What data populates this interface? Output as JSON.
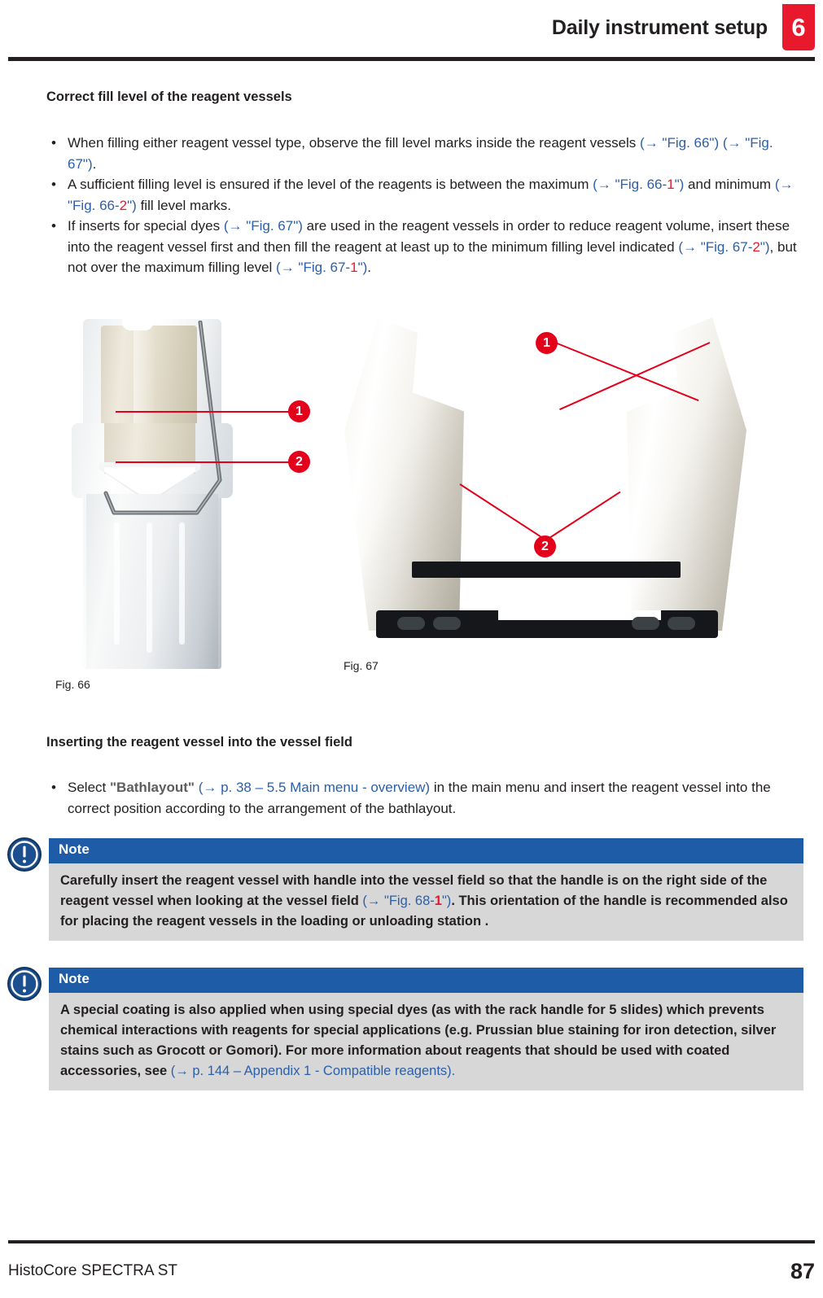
{
  "header": {
    "title": "Daily instrument setup",
    "chapter_number": "6",
    "badge_color": "#e8192c"
  },
  "section1": {
    "heading": "Correct fill level of the reagent vessels",
    "bullets": [
      {
        "parts": [
          {
            "t": "When filling either reagent vessel type, observe the fill level marks inside the reagent vessels ",
            "s": "plain"
          },
          {
            "t": "(→ \"Fig. 66\") (→ \"Fig. 67\")",
            "s": "link"
          },
          {
            "t": ".",
            "s": "plain"
          }
        ]
      },
      {
        "parts": [
          {
            "t": "A sufficient filling level is ensured if the level of the reagents is between the maximum ",
            "s": "plain"
          },
          {
            "t": "(→ \"Fig. 66-",
            "s": "link"
          },
          {
            "t": "1",
            "s": "link-red"
          },
          {
            "t": "\")",
            "s": "link"
          },
          {
            "t": " and minimum ",
            "s": "plain"
          },
          {
            "t": "(→ \"Fig. 66-",
            "s": "link"
          },
          {
            "t": "2",
            "s": "link-red"
          },
          {
            "t": "\")",
            "s": "link"
          },
          {
            "t": " fill level marks.",
            "s": "plain"
          }
        ]
      },
      {
        "parts": [
          {
            "t": "If inserts for special dyes ",
            "s": "plain"
          },
          {
            "t": "(→ \"Fig. 67\")",
            "s": "link"
          },
          {
            "t": " are used in the reagent vessels  in order to reduce reagent volume, insert these into the reagent vessel first and then fill the reagent at least up to the minimum filling level indicated ",
            "s": "plain"
          },
          {
            "t": "(→ \"Fig. 67-",
            "s": "link"
          },
          {
            "t": "2",
            "s": "link-red"
          },
          {
            "t": "\")",
            "s": "link"
          },
          {
            "t": ", but not over the maximum filling level ",
            "s": "plain"
          },
          {
            "t": "(→ \"Fig. 67-",
            "s": "link"
          },
          {
            "t": "1",
            "s": "link-red"
          },
          {
            "t": "\")",
            "s": "link"
          },
          {
            "t": ".",
            "s": "plain"
          }
        ]
      }
    ]
  },
  "figures": {
    "fig66": {
      "caption": "Fig. 66",
      "callouts": [
        {
          "label": "1"
        },
        {
          "label": "2"
        }
      ]
    },
    "fig67": {
      "caption": "Fig. 67",
      "callouts": [
        {
          "label": "1"
        },
        {
          "label": "2"
        }
      ]
    }
  },
  "section2": {
    "heading": "Inserting the reagent vessel into the vessel field",
    "bullets": [
      {
        "parts": [
          {
            "t": "Select ",
            "s": "plain"
          },
          {
            "t": "\"Bathlayout\"",
            "s": "grey"
          },
          {
            "t": " ",
            "s": "plain"
          },
          {
            "t": "(→ p. 38 – 5.5 Main menu - overview)",
            "s": "link"
          },
          {
            "t": " in the main menu and insert the reagent vessel into the correct position according to the arrangement of the bathlayout.",
            "s": "plain"
          }
        ]
      }
    ]
  },
  "notes": [
    {
      "title": "Note",
      "icon": "note-info-icon",
      "parts": [
        {
          "t": "Carefully insert the reagent vessel with handle into the vessel field so that the handle is on the right side of the reagent vessel when looking at the vessel field ",
          "s": "plain"
        },
        {
          "t": "(→ \"Fig. 68-",
          "s": "link"
        },
        {
          "t": "1",
          "s": "link-red"
        },
        {
          "t": "\")",
          "s": "link"
        },
        {
          "t": ". This orientation of the handle is recommended also for placing the reagent vessels in the loading or unloading station  .",
          "s": "plain"
        }
      ]
    },
    {
      "title": "Note",
      "icon": "note-info-icon",
      "parts": [
        {
          "t": "A special coating is also applied when using special dyes (as with the rack handle for 5 slides) which prevents chemical interactions with reagents for special applications (e.g. Prussian blue staining for iron detection, silver stains such as Grocott or Gomori). For more information about reagents that should be used with coated accessories, see ",
          "s": "plain"
        },
        {
          "t": "(→ p. 144 – Appendix 1 - Compatible reagents).",
          "s": "link"
        }
      ]
    }
  ],
  "footer": {
    "product": "HistoCore SPECTRA ST",
    "page_number": "87"
  }
}
